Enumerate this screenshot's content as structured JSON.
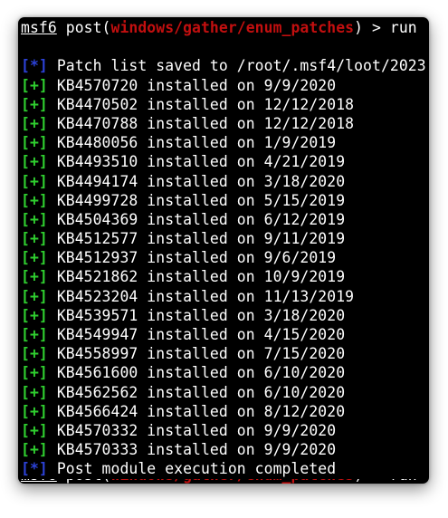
{
  "command": {
    "prompt": "msf6",
    "word": "post(",
    "module": "windows/gather/enum_patches",
    "suffix": ") > run"
  },
  "tags": {
    "plus": "[+]",
    "info": "[*]"
  },
  "saved_message": "Patch list saved to /root/.msf4/loot/2023",
  "patches": [
    "KB4570720 installed on 9/9/2020",
    "KB4470502 installed on 12/12/2018",
    "KB4470788 installed on 12/12/2018",
    "KB4480056 installed on 1/9/2019",
    "KB4493510 installed on 4/21/2019",
    "KB4494174 installed on 3/18/2020",
    "KB4499728 installed on 5/15/2019",
    "KB4504369 installed on 6/12/2019",
    "KB4512577 installed on 9/11/2019",
    "KB4512937 installed on 9/6/2019",
    "KB4521862 installed on 10/9/2019",
    "KB4523204 installed on 11/13/2019",
    "KB4539571 installed on 3/18/2020",
    "KB4549947 installed on 4/15/2020",
    "KB4558997 installed on 7/15/2020",
    "KB4561600 installed on 6/10/2020",
    "KB4562562 installed on 6/10/2020",
    "KB4566424 installed on 8/12/2020",
    "KB4570332 installed on 9/9/2020",
    "KB4570333 installed on 9/9/2020"
  ],
  "completed_message": "Post module execution completed",
  "colors": {
    "background": "#000000",
    "text": "#ffffff",
    "module": "#c20f0f",
    "success_tag": "#2fcf2f",
    "info_tag": "#2c42d8"
  }
}
